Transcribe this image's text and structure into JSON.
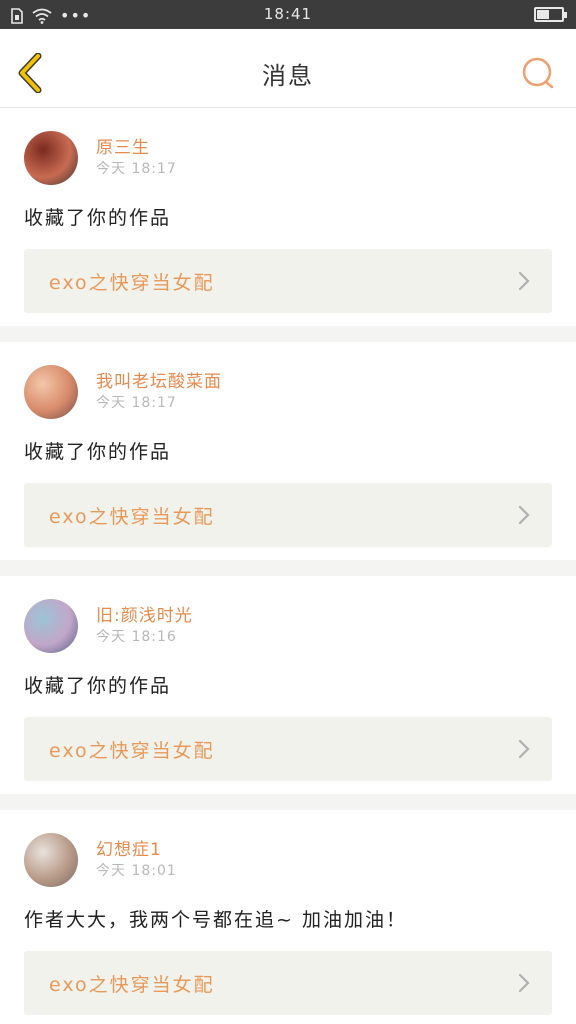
{
  "status_bar": {
    "time": "18:41",
    "more": "•••",
    "battery_level": 0.45
  },
  "header": {
    "title": "消息"
  },
  "messages": [
    {
      "username": "原三生",
      "time": "今天 18:17",
      "text": "收藏了你的作品",
      "work_title": "exo之快穿当女配",
      "avatar_colors": [
        "#7a2a20",
        "#c96b52",
        "#3a3030"
      ]
    },
    {
      "username": "我叫老坛酸菜面",
      "time": "今天 18:17",
      "text": "收藏了你的作品",
      "work_title": "exo之快穿当女配",
      "avatar_colors": [
        "#f2c7a8",
        "#d88a6a",
        "#6c4a48"
      ]
    },
    {
      "username": "旧:颜浅时光",
      "time": "今天 18:16",
      "text": "收藏了你的作品",
      "work_title": "exo之快穿当女配",
      "avatar_colors": [
        "#9cc4d6",
        "#c2a6c8",
        "#4d5e86"
      ]
    },
    {
      "username": "幻想症1",
      "time": "今天 18:01",
      "text": "作者大大，我两个号都在追~ 加油加油！",
      "work_title": "exo之快穿当女配",
      "avatar_colors": [
        "#e8e2dc",
        "#b89a88",
        "#7a6a60"
      ]
    }
  ],
  "colors": {
    "accent": "#e68a4e",
    "back_icon": "#e8b400",
    "search_icon": "#f0a070"
  }
}
